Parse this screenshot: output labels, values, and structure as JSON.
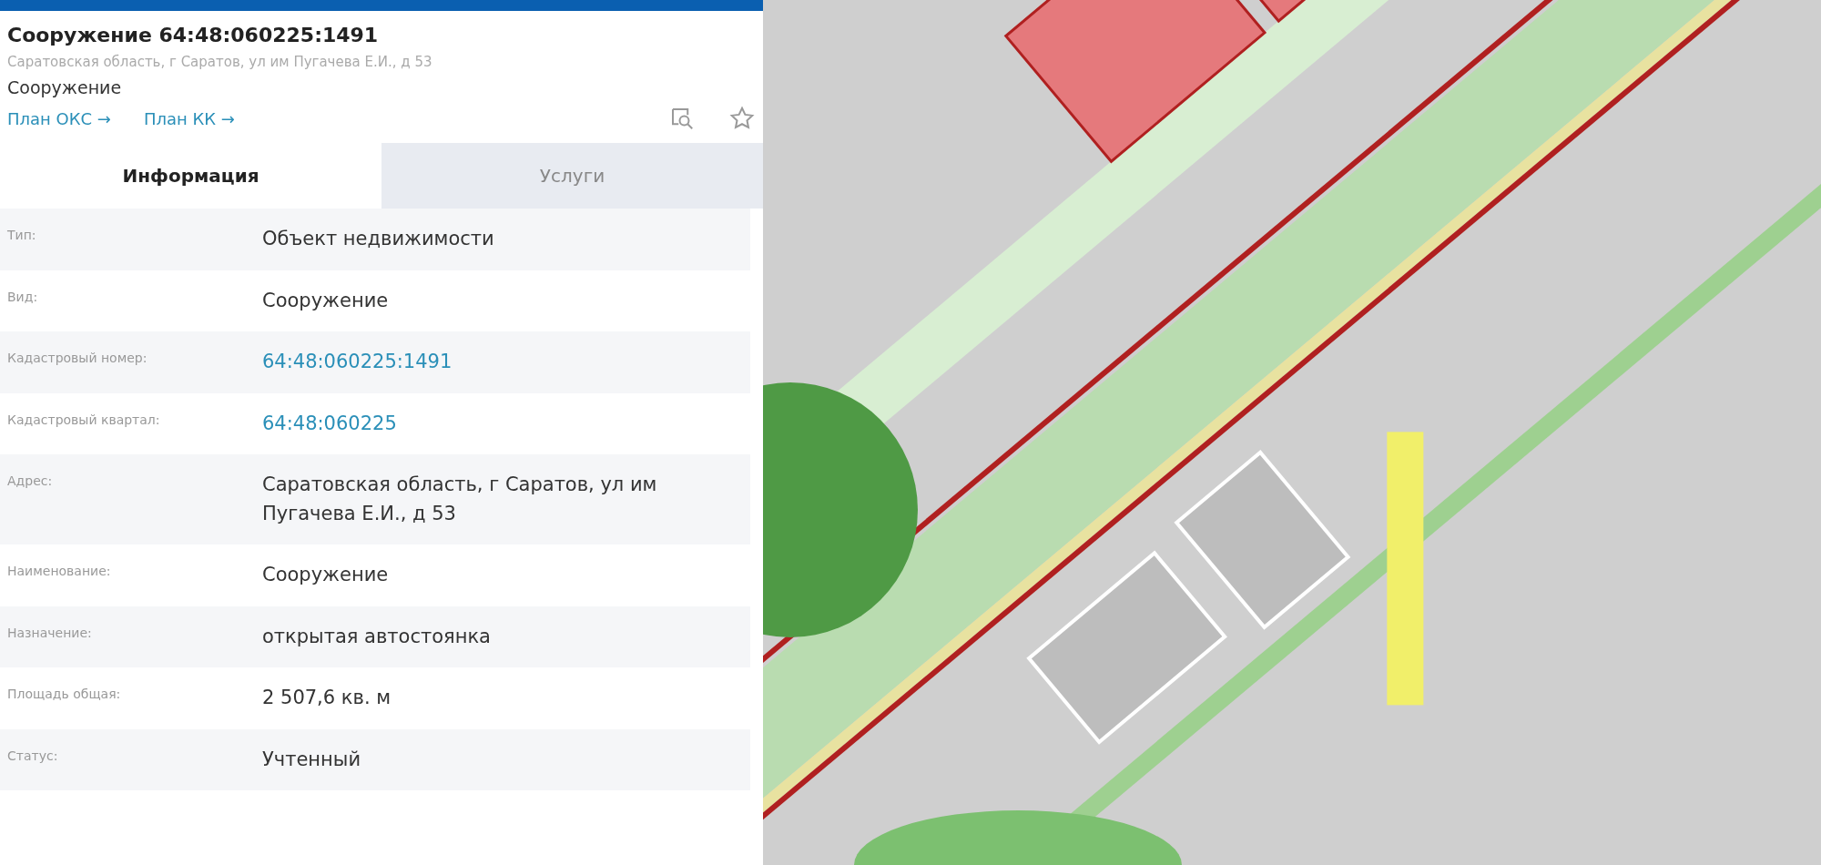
{
  "object": {
    "title": "Сооружение 64:48:060225:1491",
    "address": "Саратовская область, г Саратов, ул им Пугачева Е.И., д 53",
    "type": "Сооружение",
    "links": [
      "План ОКС →",
      "План КК →"
    ]
  },
  "tabs": [
    {
      "label": "Информация",
      "selected": true
    },
    {
      "label": "Услуги",
      "selected": false
    }
  ],
  "rows": [
    {
      "label": "Тип:",
      "value": "Объект недвижимости",
      "kind": "text"
    },
    {
      "label": "Вид:",
      "value": "Сооружение",
      "kind": "text"
    },
    {
      "label": "Кадастровый номер:",
      "value": "64:48:060225:1491",
      "kind": "link"
    },
    {
      "label": "Кадастровый квартал:",
      "value": "64:48:060225",
      "kind": "link"
    },
    {
      "label": "Адрес:",
      "value": "Саратовская область, г Саратов, ул им Пугачева Е.И., д 53",
      "kind": "text"
    },
    {
      "label": "Наименование:",
      "value": "Сооружение",
      "kind": "text"
    },
    {
      "label": "Назначение:",
      "value": "открытая автостоянка",
      "kind": "text"
    },
    {
      "label": "Площадь общая:",
      "value": "2 507,6 кв. м",
      "kind": "text"
    },
    {
      "label": "Статус:",
      "value": "Учтенный",
      "kind": "text"
    }
  ]
}
